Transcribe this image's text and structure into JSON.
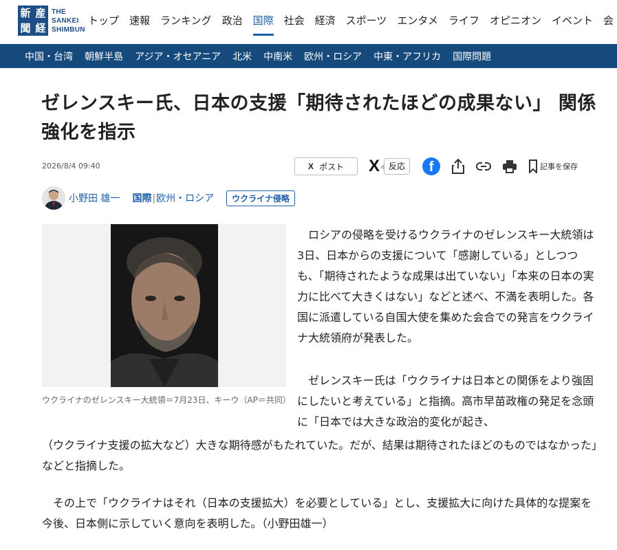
{
  "header": {
    "logo": {
      "mark": [
        "新",
        "産",
        "聞",
        "経"
      ],
      "text_lines": [
        "THE",
        "SANKEI",
        "SHIMBUN"
      ]
    },
    "nav": [
      "トップ",
      "速報",
      "ランキング",
      "政治",
      "国際",
      "社会",
      "経済",
      "スポーツ",
      "エンタメ",
      "ライフ",
      "オピニオン",
      "イベント",
      "会"
    ],
    "active_nav": "国際"
  },
  "subnav": [
    "中国・台湾",
    "朝鮮半島",
    "アジア・オセアニア",
    "北米",
    "中南米",
    "欧州・ロシア",
    "中東・アフリカ",
    "国際問題"
  ],
  "article": {
    "headline": "ゼレンスキー氏、日本の支援「期待されたほどの成果ない」 関係強化を指示",
    "date": "2026/8/4 09:40",
    "share": {
      "post_label": "ポスト",
      "x_glyph": "X",
      "react_label": "反応",
      "save_label": "記事を保存"
    },
    "author": "小野田 雄一",
    "category_main": "国際",
    "category_sub": "欧州・ロシア",
    "tag": "ウクライナ侵略",
    "photo_caption": "ウクライナのゼレンスキー大統領＝7月23日、キーウ（AP＝共同）",
    "paragraphs": {
      "p1": "　ロシアの侵略を受けるウクライナのゼレンスキー大統領は3日、日本からの支援について「感謝している」としつつも、「期待されたような成果は出ていない」「本来の日本の実力に比べて大きくはない」などと述べ、不満を表明した。各国に派遣している自国大使を集めた会合での発言をウクライナ大統領府が発表した。",
      "p2a": "　ゼレンスキー氏は「ウクライナは日本との関係をより強固にしたいと考えている」と指摘。高市早苗政権の発足を念頭に「日本では大きな政治的変化が起き、",
      "p2b": "（ウクライナ支援の拡大など）大きな期待感がもたれていた。だが、結果は期待されたほどのものではなかった」などと指摘した。",
      "p3": "　その上で「ウクライナはそれ（日本の支援拡大）を必要としている」とし、支援拡大に向けた具体的な提案を今後、日本側に示していく意向を表明した。（小野田雄一）"
    }
  },
  "colors": {
    "brand": "#1f4e86",
    "subnav_bg": "#164a7c",
    "link": "#1f5fa8",
    "facebook": "#1877f2"
  }
}
